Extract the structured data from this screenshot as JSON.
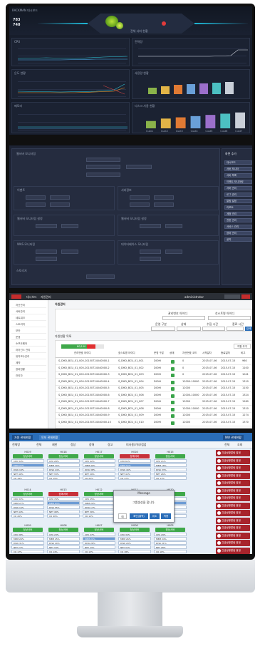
{
  "dashboard": {
    "title": "RACKMAN 대시보드",
    "stat_top": "783",
    "stat_bottom": "748",
    "center_caption": "전체 서버 현황",
    "panels": [
      "CPU",
      "전력량",
      "온도 현황",
      "사용량 현황",
      "메모리",
      "디스크 사용 현황"
    ],
    "chart_data": {
      "type": "bar",
      "categories": [
        "Cust1",
        "Cust2",
        "Cust3",
        "Cust4",
        "Cust5",
        "Cust6",
        "Cust7"
      ],
      "values": [
        30,
        40,
        45,
        50,
        55,
        60,
        65
      ],
      "title": "",
      "xlabel": "",
      "ylabel": ""
    }
  },
  "form": {
    "sections": [
      "웹서버 모니터링",
      "이벤트",
      "서버정보",
      "웹서버 모니터링 설정",
      "WAS 모니터링",
      "데이터베이스 모니터링",
      "스토리지"
    ],
    "right_title": "화면 추가",
    "right_items": [
      "대시보드",
      "서버 모니터",
      "서버 목록",
      "이벤트 모니터링",
      "서버 관리",
      "로그 관리",
      "알림 설정",
      "리포트",
      "계정 관리",
      "권한 관리",
      "서비스 관리",
      "장비 관리",
      "공지"
    ]
  },
  "table": {
    "nav_tabs": [
      "대시보드",
      "자원관리"
    ],
    "user": "administrator",
    "page_title": "자원관리",
    "search_labels": [
      "관리번호 아이디",
      "호스트명 아이디",
      "운영 구분",
      "상태",
      "수집 시간",
      "종료 시간"
    ],
    "search_button": "검색",
    "list_title": "자원현황 목록",
    "progress_label": "80/100",
    "add_button": "자원 추가",
    "columns": [
      "관리번호 아이디",
      "호스트명 아이디",
      "운영 구분",
      "상태",
      "자산번호 코드",
      "시작일자",
      "종료일자",
      "비고"
    ],
    "rows": [
      [
        "S_DHD_BCU_01_000-20150724040000-1",
        "S_DHD_BCU_01_001",
        "DIOHI",
        "0",
        "2015-07-06",
        "2015-07-15",
        "960"
      ],
      [
        "S_DHD_BCU_01_000-20150724040000-2",
        "S_DHD_BCU_01_002",
        "DIOHI",
        "0",
        "2015-07-06",
        "2015-07-15",
        "1100"
      ],
      [
        "S_DHD_BCU_01_000-20150724040000-3",
        "S_DHD_BCU_01_003",
        "DIOHI",
        "0",
        "2015-07-06",
        "2015-07-15",
        "1041"
      ],
      [
        "S_DHD_BCU_01_000-20150724040000-4",
        "S_DHD_BCU_01_004",
        "DIOHI",
        "12000-10000",
        "2015-07-06",
        "2015-07-15",
        "1310"
      ],
      [
        "S_DHD_BCU_01_000-20150724040000-5",
        "S_DHD_BCU_01_005",
        "DIOHI",
        "12000",
        "2015-07-06",
        "2015-07-15",
        "1150"
      ],
      [
        "S_DHD_BCU_01_000-20150724040000-6",
        "S_DHD_BCU_01_006",
        "DIOHI",
        "12000-10000",
        "2015-07-06",
        "2015-07-15",
        "1324"
      ],
      [
        "S_DHD_BCU_01_000-20150724040000-7",
        "S_DHD_BCU_01_007",
        "DIOHI",
        "12000",
        "2015-07-06",
        "2015-07-15",
        "1280"
      ],
      [
        "S_DHD_BCU_01_000-20150724040000-8",
        "S_DHD_BCU_01_008",
        "DIOHI",
        "12000-10000",
        "2015-07-06",
        "2015-07-15",
        "1310"
      ],
      [
        "S_DHD_BCU_01_000-20150724040000-9",
        "S_DHD_BCU_01_009",
        "DIOHI",
        "12000",
        "2015-07-06",
        "2015-07-15",
        "1274"
      ],
      [
        "S_DHD_BCU_01_000-20150724040000-10",
        "S_DHD_BCU_01_010",
        "DIOHI",
        "12000",
        "2015-07-06",
        "2015-07-15",
        "1370"
      ]
    ],
    "sidebar": [
      "자산관리",
      "서버관리",
      "네트워크",
      "스토리지",
      "보안",
      "운영",
      "소프트웨어",
      "라이선스 관리",
      "유지보수관리",
      "계약",
      "장비현황",
      "관리자"
    ]
  },
  "grid": {
    "tabs": [
      "자원 관제현황",
      "인포 관제현황"
    ],
    "right_tab": "NW 관제현황",
    "tool_labels": [
      "전체망",
      "전체",
      "제한",
      "정상",
      "장애",
      "경고",
      "미사용/기타/점검"
    ],
    "cards": [
      {
        "title": "H019",
        "btn": "정상서버",
        "state": "ok",
        "rows": [
          "CPU 34%",
          "MEM 22%",
          "DISK 18%",
          "NET 40%",
          "I/O 19%"
        ]
      },
      {
        "title": "H018",
        "btn": "정상서버",
        "state": "ok",
        "rows": [
          "CPU 28%",
          "MEM 30%",
          "DISK 24%",
          "NET 33%",
          "I/O 15%"
        ]
      },
      {
        "title": "H017",
        "btn": "정상서버",
        "state": "ok",
        "rows": [
          "CPU 42%",
          "MEM 40%",
          "DISK 38%",
          "NET 29%",
          "I/O 22%"
        ]
      },
      {
        "title": "H016",
        "btn": "장애서버",
        "state": "err",
        "rows": [
          "CPU 61%",
          "MEM 52%",
          "DISK 49%",
          "NET 41%",
          "I/O 37%"
        ]
      },
      {
        "title": "H015",
        "btn": "정상서버",
        "state": "ok",
        "rows": [
          "CPU 21%",
          "MEM 18%",
          "DISK 33%",
          "NET 26%",
          "I/O 11%"
        ]
      },
      {
        "title": "H014",
        "btn": "정상서버",
        "state": "ok",
        "rows": [
          "CPU 31%",
          "MEM 27%",
          "DISK 19%",
          "NET 44%",
          "I/O 20%"
        ]
      },
      {
        "title": "H013",
        "btn": "장애서버",
        "state": "err",
        "rows": [
          "CPU 70%",
          "MEM 63%",
          "DISK 55%",
          "NET 48%",
          "I/O 40%"
        ]
      },
      {
        "title": "H012",
        "btn": "정상서버",
        "state": "ok",
        "rows": [
          "CPU 25%",
          "MEM 20%",
          "DISK 17%",
          "NET 30%",
          "I/O 12%"
        ]
      },
      {
        "title": "H011",
        "btn": "정상서버",
        "state": "ok",
        "rows": [
          "CPU 39%",
          "MEM 33%",
          "DISK 28%",
          "NET 35%",
          "I/O 24%"
        ]
      },
      {
        "title": "H010",
        "btn": "정상서버",
        "state": "ok",
        "rows": [
          "CPU 19%",
          "MEM 15%",
          "DISK 22%",
          "NET 18%",
          "I/O 10%"
        ]
      },
      {
        "title": "H009",
        "btn": "정상서버",
        "state": "ok",
        "rows": [
          "CPU 36%",
          "MEM 29%",
          "DISK 31%",
          "NET 27%",
          "I/O 17%"
        ]
      },
      {
        "title": "H008",
        "btn": "정상서버",
        "state": "ok",
        "rows": [
          "CPU 23%",
          "MEM 25%",
          "DISK 20%",
          "NET 34%",
          "I/O 14%"
        ]
      },
      {
        "title": "H007",
        "btn": "정상서버",
        "state": "ok",
        "rows": [
          "CPU 27%",
          "MEM 21%",
          "DISK 26%",
          "NET 23%",
          "I/O 13%"
        ]
      },
      {
        "title": "H006",
        "btn": "정상서버",
        "state": "ok",
        "rows": [
          "CPU 32%",
          "MEM 26%",
          "DISK 29%",
          "NET 31%",
          "I/O 18%"
        ]
      },
      {
        "title": "H005",
        "btn": "정상서버",
        "state": "ok",
        "rows": [
          "CPU 29%",
          "MEM 24%",
          "DISK 21%",
          "NET 28%",
          "I/O 16%"
        ]
      }
    ],
    "modal": {
      "title": "Message",
      "body": "그룹생성을 합니다.",
      "buttons": [
        "예",
        "확인(출력)",
        "취소",
        "적용"
      ]
    },
    "right_header": [
      "전체",
      "조회"
    ],
    "right_buttons": [
      "긴급상황알림 발생",
      "긴급상황알림 발생",
      "긴급상황알림 발생",
      "긴급상황알림 발생",
      "긴급상황알림 발생",
      "긴급상황알림 발생",
      "긴급상황알림 발생",
      "긴급상황알림 발생",
      "긴급상황알림 발생",
      "긴급상황알림 발생",
      "긴급상황알림 발생",
      "긴급상황알림 발생",
      "긴급상황알림 발생",
      "긴급상황알림 발생"
    ]
  },
  "colors": {
    "accent": "#2a6db8",
    "ok": "#3fa84a",
    "err": "#c7313a",
    "dark_bg": "#171d2b"
  }
}
